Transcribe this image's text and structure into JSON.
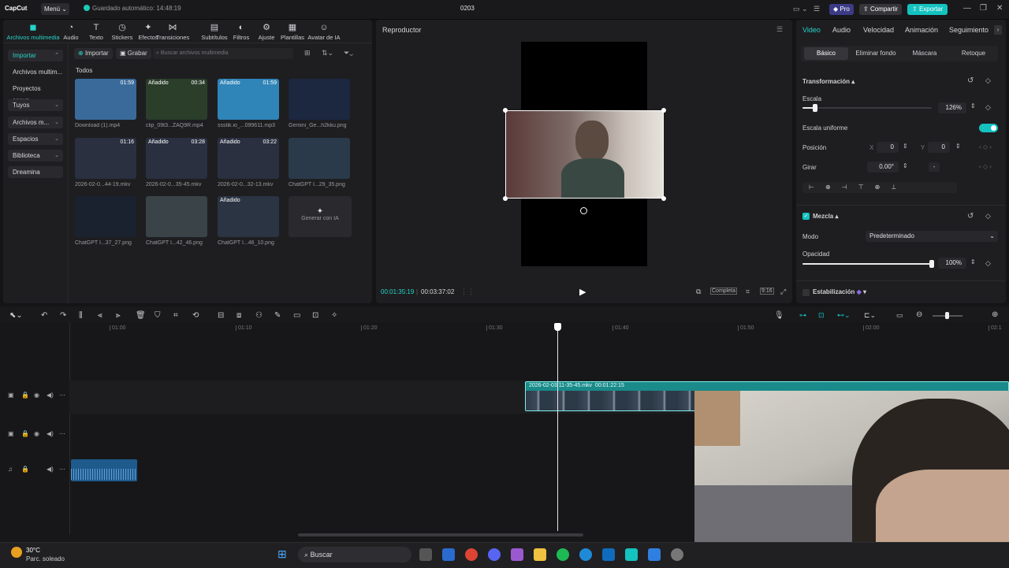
{
  "app": {
    "logo": "CapCut",
    "menu": "Menú",
    "autosave": "Guardado automático: 14:48:19",
    "project_title": "0203",
    "pro": "Pro",
    "share": "Compartir",
    "export": "Exportar"
  },
  "toolbar": {
    "items": [
      {
        "label": "Archivos multimedia",
        "icon": "media-icon"
      },
      {
        "label": "Audio",
        "icon": "audio-icon"
      },
      {
        "label": "Texto",
        "icon": "text-icon"
      },
      {
        "label": "Stickers",
        "icon": "sticker-icon"
      },
      {
        "label": "Efectos",
        "icon": "effects-icon"
      },
      {
        "label": "Transiciones",
        "icon": "transition-icon"
      },
      {
        "label": "Subtítulos",
        "icon": "subtitles-icon"
      },
      {
        "label": "Filtros",
        "icon": "filter-icon"
      },
      {
        "label": "Ajuste",
        "icon": "adjust-icon"
      },
      {
        "label": "Plantillas",
        "icon": "template-icon"
      },
      {
        "label": "Avatar de IA",
        "icon": "avatar-icon"
      }
    ]
  },
  "sidebar": {
    "items": [
      {
        "label": "Importar"
      },
      {
        "label": "Archivos multim..."
      },
      {
        "label": "Proyectos secun..."
      },
      {
        "label": "Tuyos"
      },
      {
        "label": "Archivos m..."
      },
      {
        "label": "Espacios"
      },
      {
        "label": "Biblioteca"
      },
      {
        "label": "Dreamina"
      }
    ]
  },
  "media": {
    "import_btn": "Importar",
    "record_btn": "Grabar",
    "search_placeholder": "Buscar archivos multimedia",
    "section": "Todos",
    "items": [
      {
        "name": "Download (1).mp4",
        "badge": "",
        "duration": "01:59",
        "color": "#3a6a9a"
      },
      {
        "name": "clip_09t3...ZAQ9R.mp4",
        "badge": "Añadido",
        "duration": "00:34",
        "color": "#2a3e2a"
      },
      {
        "name": "ssstik.io_...099611.mp3",
        "badge": "Añadido",
        "duration": "01:59",
        "color": "#2f84b8"
      },
      {
        "name": "Gemini_Ge...h2kku.png",
        "badge": "",
        "duration": "",
        "color": "#1c2740"
      },
      {
        "name": "2026-02-0...44-19.mkv",
        "badge": "",
        "duration": "01:16",
        "color": "#2a3040"
      },
      {
        "name": "2026-02-0...35-45.mkv",
        "badge": "Añadido",
        "duration": "03:28",
        "color": "#2a3040"
      },
      {
        "name": "2026-02-0...32-13.mkv",
        "badge": "Añadido",
        "duration": "03:22",
        "color": "#2a3040"
      },
      {
        "name": "ChatGPT I...29_35.png",
        "badge": "",
        "duration": "",
        "color": "#2a3a4a"
      },
      {
        "name": "ChatGPT I...37_27.png",
        "badge": "",
        "duration": "",
        "color": "#1a2230"
      },
      {
        "name": "ChatGPT I...42_46.png",
        "badge": "",
        "duration": "",
        "color": "#3a4448"
      },
      {
        "name": "ChatGPT I...46_10.png",
        "badge": "Añadido",
        "duration": "",
        "color": "#2a3442"
      }
    ],
    "generate_ai": "Generar con IA"
  },
  "player": {
    "title": "Reproductor",
    "current_time": "00:01:35:19",
    "total_time": "00:03:37:02",
    "full_label": "Completa",
    "ratio": "9:16"
  },
  "inspector": {
    "tabs": [
      "Video",
      "Audio",
      "Velocidad",
      "Animación",
      "Seguimiento"
    ],
    "subtabs": [
      "Básico",
      "Eliminar fondo",
      "Máscara",
      "Retoque"
    ],
    "transform_title": "Transformación",
    "scale_label": "Escala",
    "scale_value": "126%",
    "scale_fraction": 0.1,
    "uniform_label": "Escala uniforme",
    "position_label": "Posición",
    "pos_x_label": "X",
    "pos_x": "0",
    "pos_y_label": "Y",
    "pos_y": "0",
    "rotate_label": "Girar",
    "rotate_value": "0.00°",
    "blend_title": "Mezcla",
    "mode_label": "Modo",
    "mode_value": "Predeterminado",
    "opacity_label": "Opacidad",
    "opacity_value": "100%",
    "opacity_fraction": 1.0,
    "stabilize_label": "Estabilización"
  },
  "timeline": {
    "ruler": [
      "01:00",
      "01:10",
      "01:20",
      "01:30",
      "01:40",
      "01:50",
      "02:00",
      "02:1"
    ],
    "clip_label": "2026-02-03 11-35-45.mkv",
    "clip_duration": "00:01:22:15"
  },
  "taskbar": {
    "temp": "30°C",
    "weather": "Parc. soleado",
    "search": "Buscar"
  },
  "colors": {
    "accent": "#14c2c0",
    "pro": "#3b3b86",
    "clip": "#1a8a8a"
  }
}
